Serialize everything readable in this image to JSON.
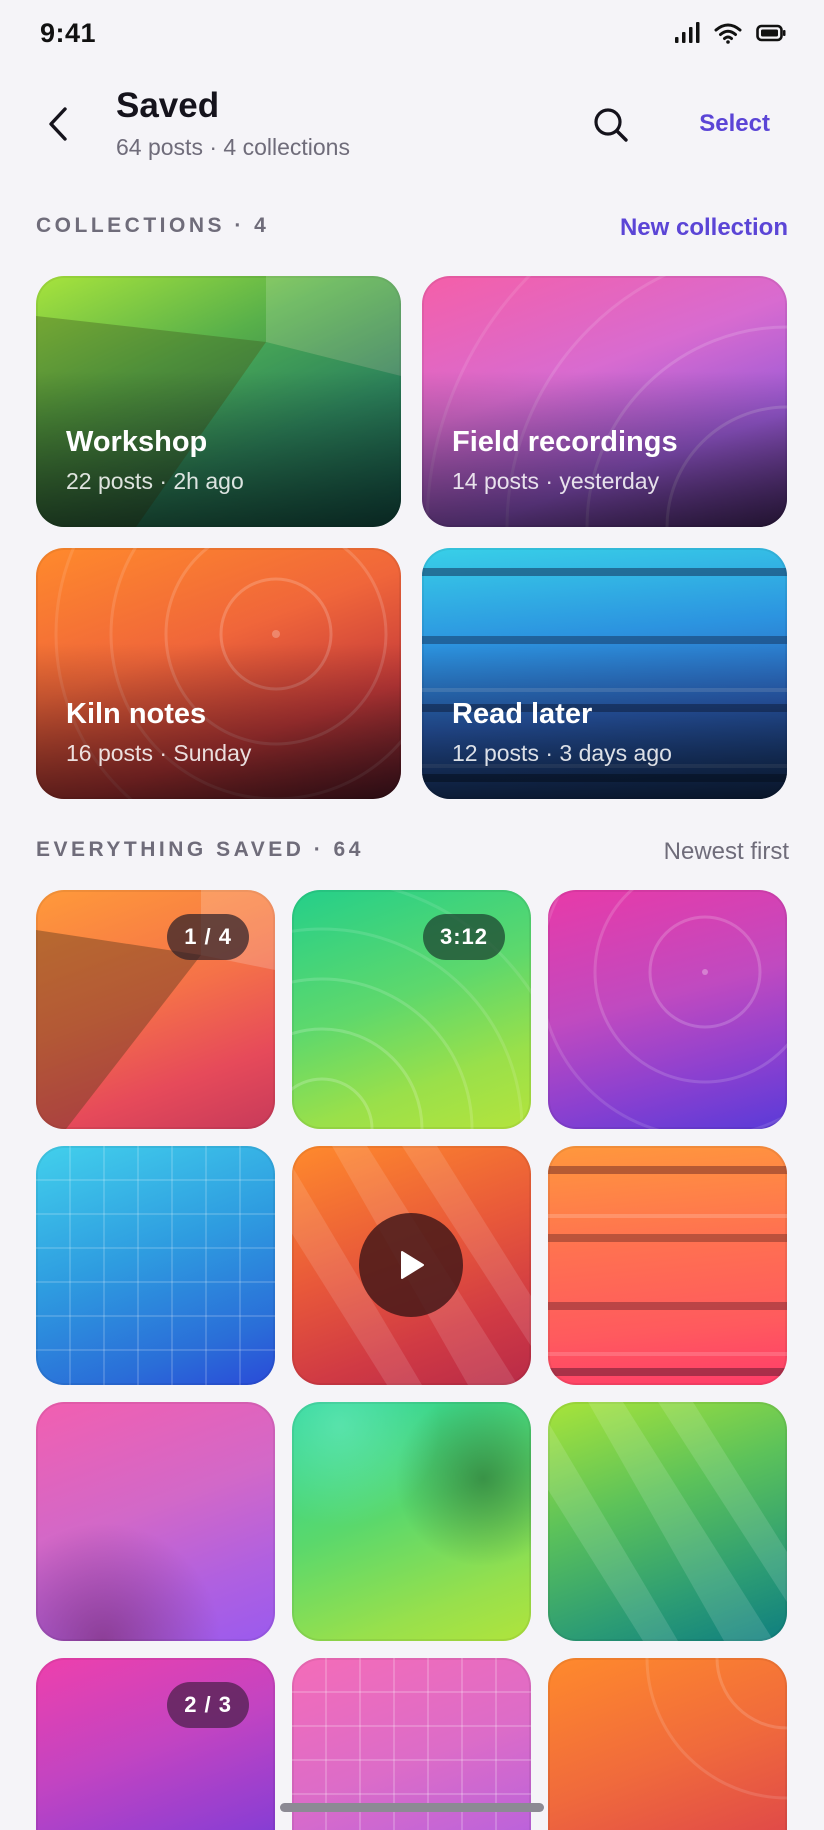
{
  "status": {
    "time": "9:41"
  },
  "header": {
    "title": "Saved",
    "subtitle": "64 posts · 4 collections",
    "select_label": "Select"
  },
  "collections_section": {
    "label": "COLLECTIONS · 4",
    "action": "New collection",
    "items": [
      {
        "title": "Workshop",
        "meta": "22 posts · 2h ago"
      },
      {
        "title": "Field recordings",
        "meta": "14 posts · yesterday"
      },
      {
        "title": "Kiln notes",
        "meta": "16 posts · Sunday"
      },
      {
        "title": "Read later",
        "meta": "12 posts · 3 days ago"
      }
    ]
  },
  "saved_section": {
    "label": "EVERYTHING SAVED · 64",
    "sort": "Newest first",
    "badges": {
      "tile1": "1 / 4",
      "tile2": "3:12",
      "tile10": "2 / 3"
    }
  },
  "colors": {
    "accent": "#5b45d6",
    "background": "#f5f4f8",
    "muted_text": "#6f6c7a"
  },
  "icons": [
    "back-chevron-icon",
    "search-icon",
    "signal-icon",
    "wifi-icon",
    "battery-icon",
    "play-icon"
  ]
}
